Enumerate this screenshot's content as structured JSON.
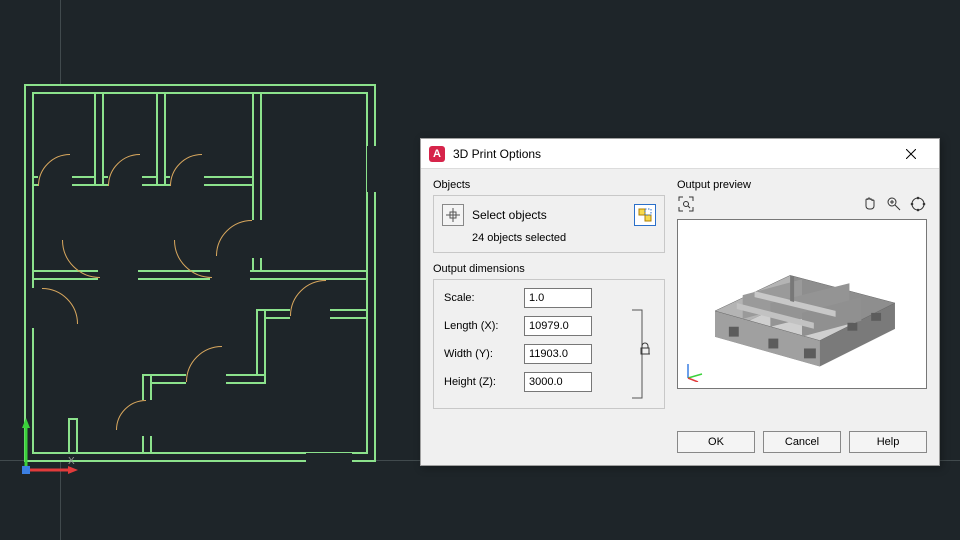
{
  "dialog": {
    "title": "3D Print Options",
    "app_letter": "A",
    "objects": {
      "label": "Objects",
      "select_label": "Select objects",
      "count_text": "24 objects selected"
    },
    "dimensions": {
      "label": "Output dimensions",
      "scale_label": "Scale:",
      "scale_value": "1.0",
      "length_label": "Length (X):",
      "length_value": "10979.0",
      "width_label": "Width (Y):",
      "width_value": "11903.0",
      "height_label": "Height (Z):",
      "height_value": "3000.0"
    },
    "preview": {
      "label": "Output preview"
    },
    "buttons": {
      "ok": "OK",
      "cancel": "Cancel",
      "help": "Help"
    }
  }
}
